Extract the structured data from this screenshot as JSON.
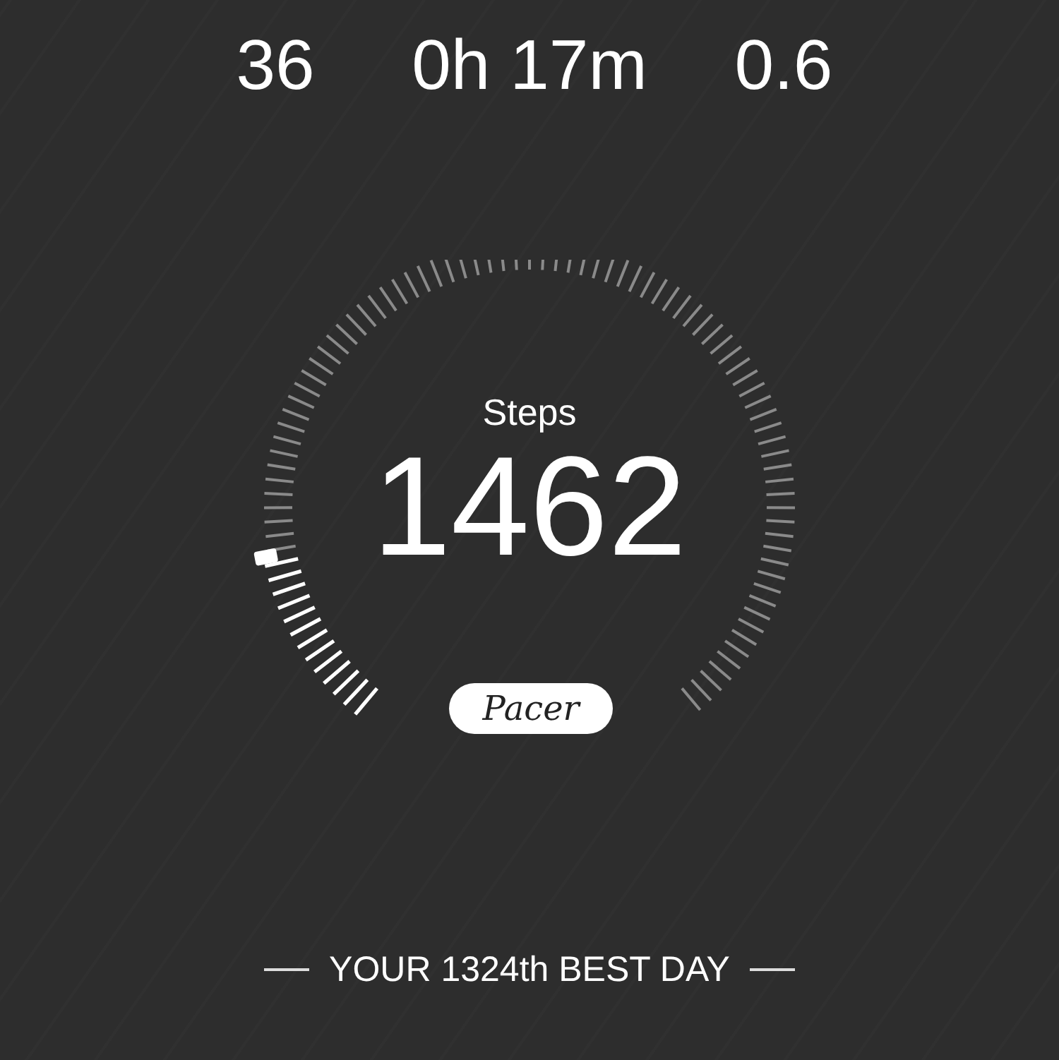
{
  "stats": [
    {
      "value": "36"
    },
    {
      "value": "0h 17m"
    },
    {
      "value": "0.6"
    }
  ],
  "gauge": {
    "label": "Steps",
    "value": "1462",
    "badge": "Pacer"
  },
  "footer": {
    "text": "YOUR 1324th BEST DAY"
  }
}
